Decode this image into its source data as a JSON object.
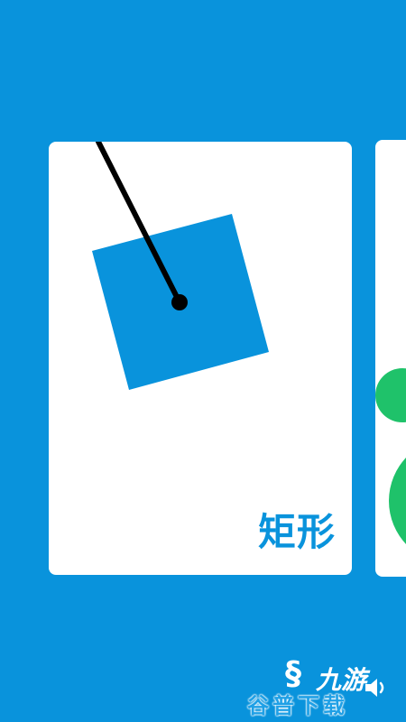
{
  "game": {
    "current_card": {
      "label": "矩形",
      "shape": "rectangle",
      "shape_color": "#0993dc"
    },
    "next_card": {
      "shape": "circle",
      "shape_color": "#1fc26a"
    }
  },
  "watermark": {
    "logo_glyph": "§",
    "brand_top": "九游",
    "brand_bottom": "谷普下载"
  },
  "colors": {
    "background": "#0993dc",
    "card": "#ffffff",
    "pendulum": "#000000",
    "accent_green": "#1fc26a"
  },
  "icons": {
    "sound": "speaker-icon"
  }
}
